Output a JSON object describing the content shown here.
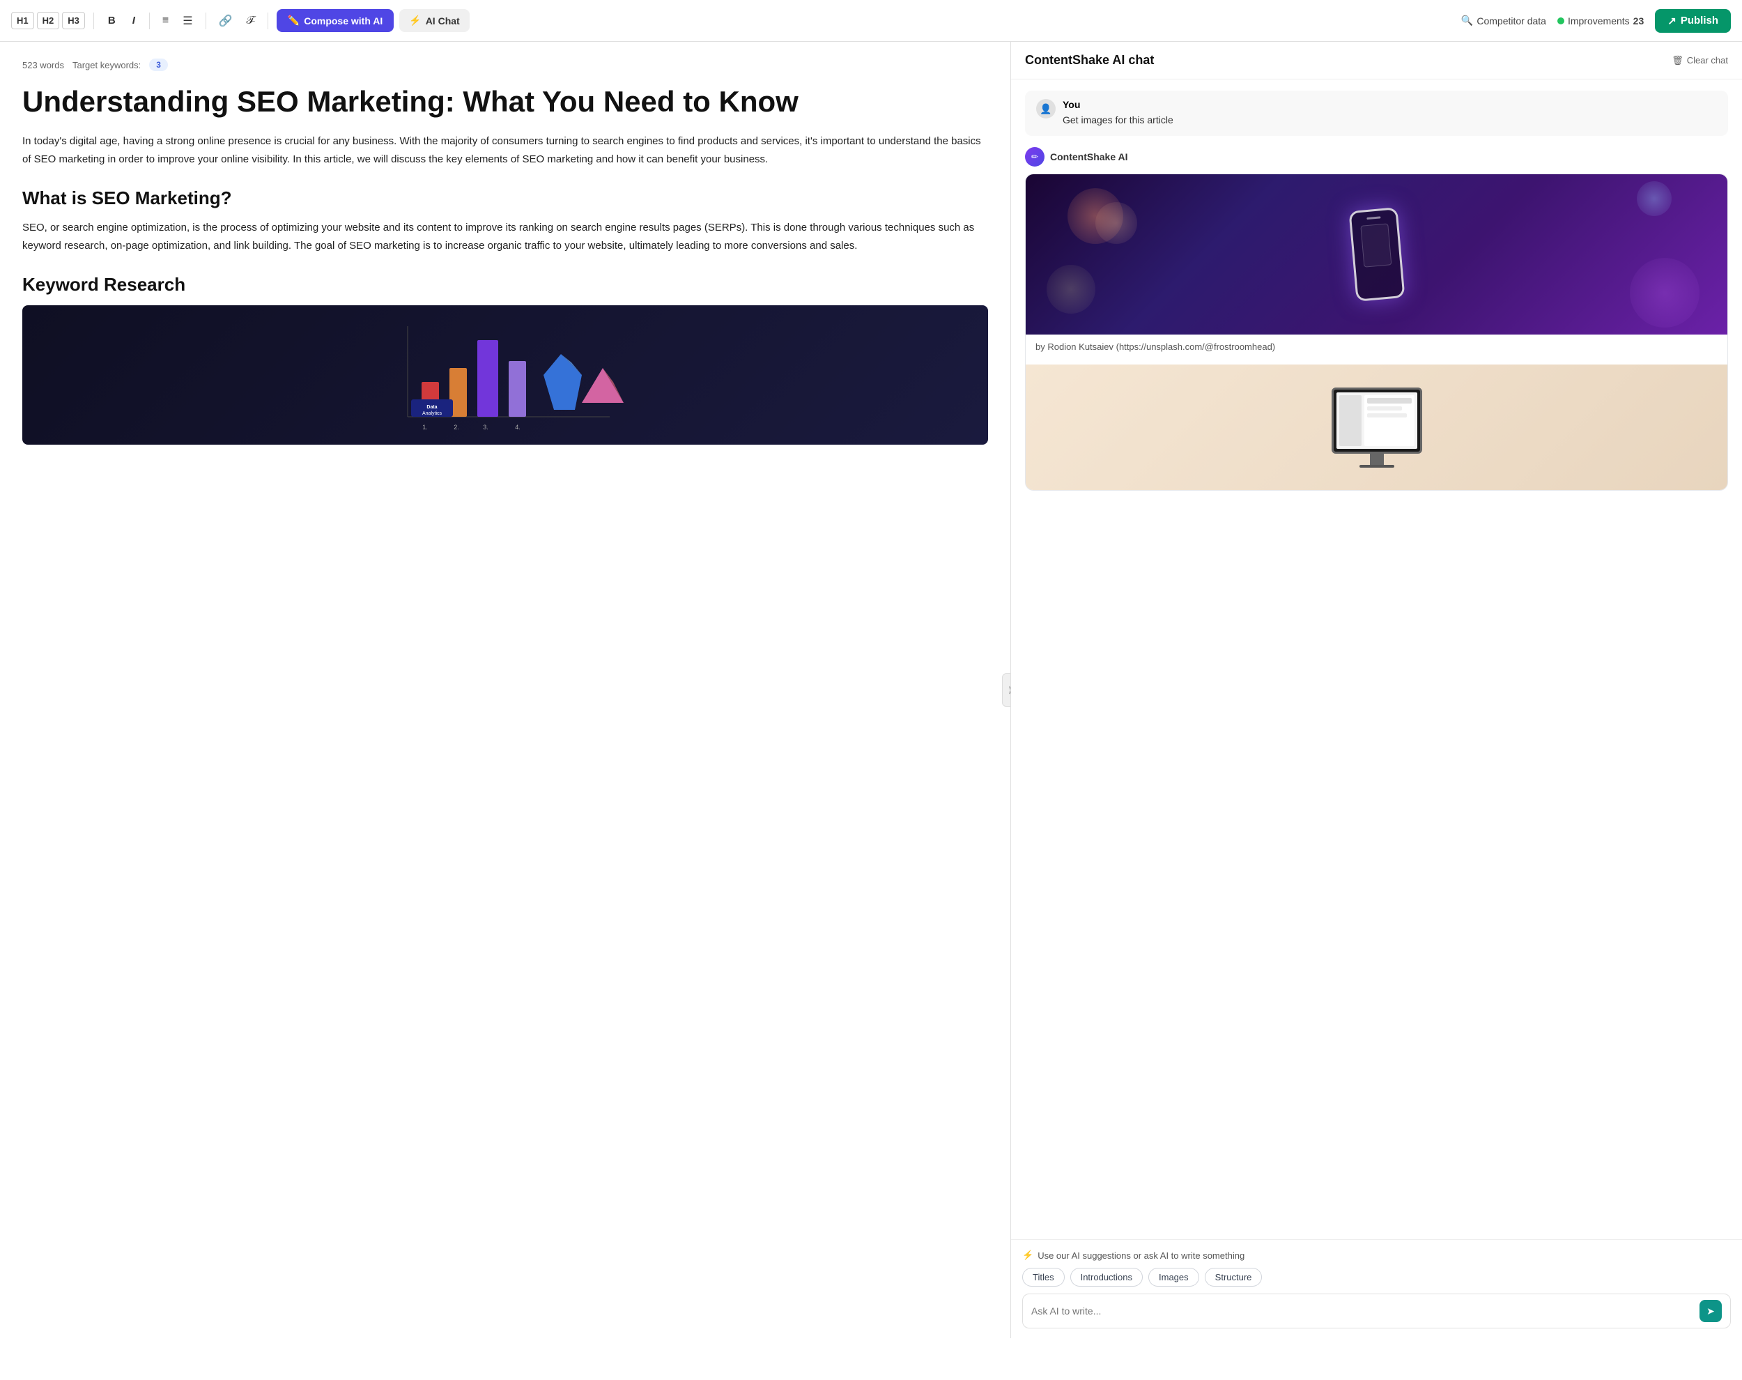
{
  "toolbar": {
    "h1_label": "H1",
    "h2_label": "H2",
    "h3_label": "H3",
    "bold_label": "B",
    "italic_label": "I",
    "compose_label": "Compose with AI",
    "ai_chat_label": "AI Chat",
    "competitor_label": "Competitor data",
    "improvements_label": "Improvements",
    "improvements_count": "23",
    "publish_label": "Publish"
  },
  "editor": {
    "word_count": "523 words",
    "keyword_label": "Target keywords:",
    "keyword_count": "3",
    "title": "Understanding SEO Marketing: What You Need to Know",
    "intro": "In today's digital age, having a strong online presence is crucial for any business. With the majority of consumers turning to search engines to find products and services, it's important to understand the basics of SEO marketing in order to improve your online visibility. In this article, we will discuss the key elements of SEO marketing and how it can benefit your business.",
    "h2_1": "What is SEO Marketing?",
    "para_1": "SEO, or search engine optimization, is the process of optimizing your website and its content to improve its ranking on search engine results pages (SERPs). This is done through various techniques such as keyword research, on-page optimization, and link building. The goal of SEO marketing is to increase organic traffic to your website, ultimately leading to more conversions and sales.",
    "h2_2": "Keyword Research"
  },
  "chat": {
    "title": "ContentShake AI chat",
    "clear_label": "Clear chat",
    "user_name": "You",
    "user_message": "Get images for this article",
    "ai_name": "ContentShake AI",
    "image1_caption": "by Rodion Kutsaiev (https://unsplash.com/@frostroomhead)",
    "suggestion_label": "Use our AI suggestions or ask AI to write something",
    "chips": [
      "Titles",
      "Introductions",
      "Images",
      "Structure"
    ],
    "input_placeholder": "Ask AI to write..."
  }
}
